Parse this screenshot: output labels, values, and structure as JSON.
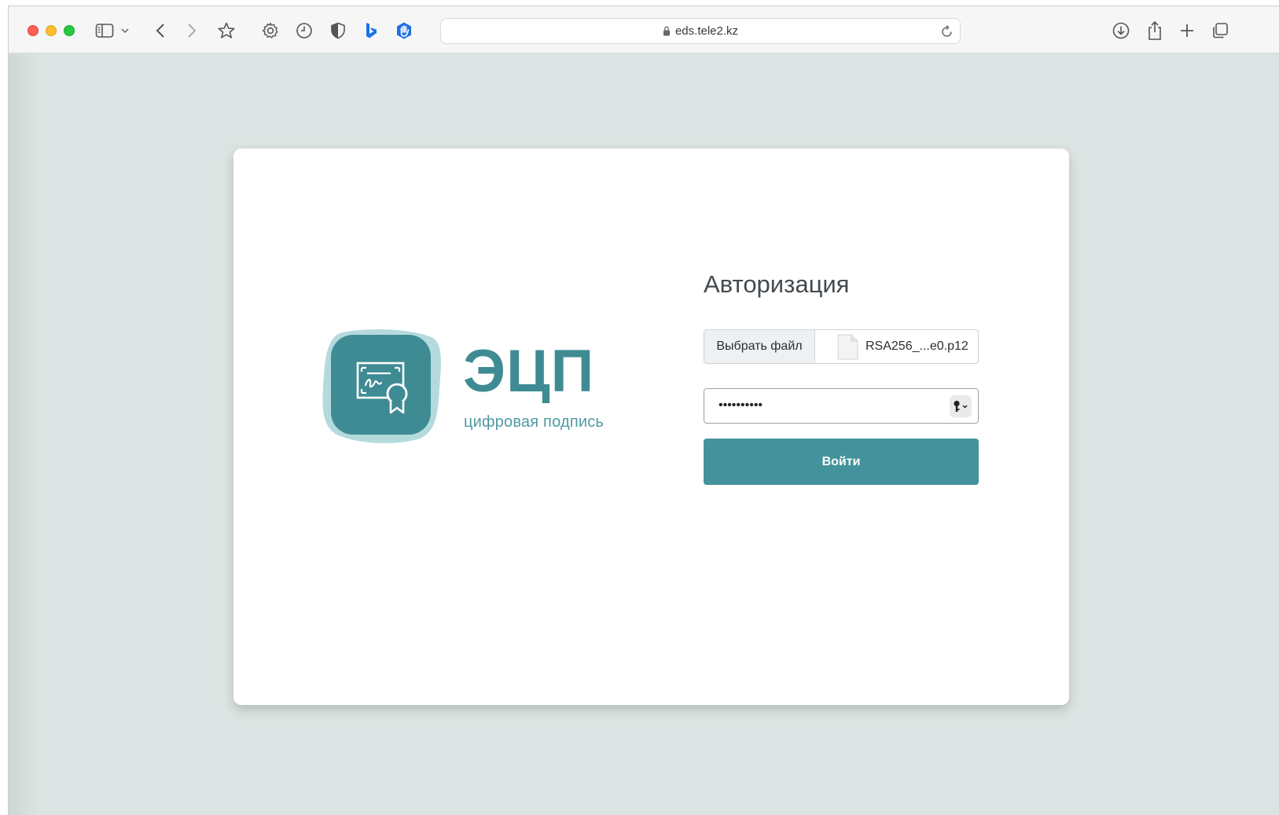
{
  "browser": {
    "url": "eds.tele2.kz",
    "icons": [
      "sidebar-icon",
      "chevron-down-icon",
      "back-icon",
      "forward-icon",
      "bookmark-star-icon",
      "gear-icon",
      "clock-icon",
      "shield-icon",
      "bing-icon",
      "hand-block-icon",
      "download-icon",
      "share-icon",
      "new-tab-plus-icon",
      "tabs-overview-icon"
    ]
  },
  "logo": {
    "word": "ЭЦП",
    "subtitle": "цифровая подпись",
    "color": "#3f8b94"
  },
  "form": {
    "title": "Авторизация",
    "file_button": "Выбрать файл",
    "file_name": "RSA256_...e0.p12",
    "password_mask": "••••••••••",
    "login_button": "Войти",
    "button_color": "#44939c"
  }
}
